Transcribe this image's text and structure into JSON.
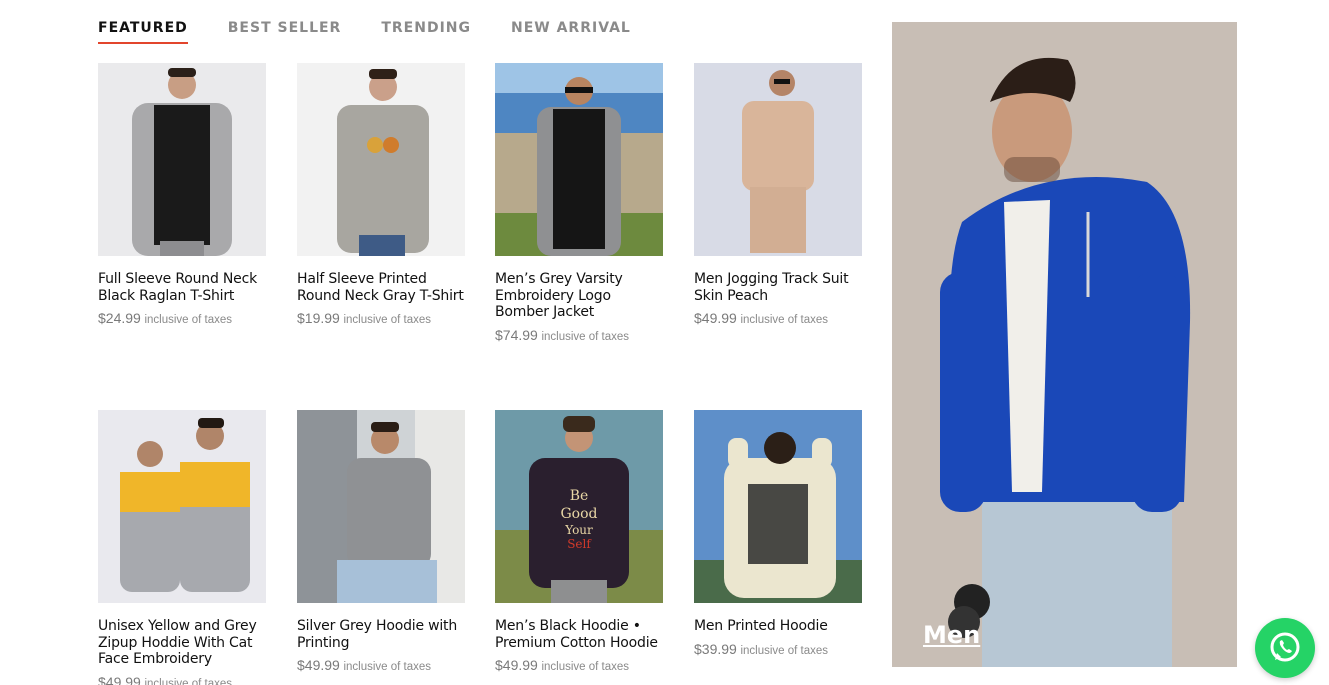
{
  "tabs": [
    {
      "label": "FEATURED",
      "active": true
    },
    {
      "label": "BEST SELLER",
      "active": false
    },
    {
      "label": "TRENDING",
      "active": false
    },
    {
      "label": "NEW ARRIVAL",
      "active": false
    }
  ],
  "tax_note": "inclusive of taxes",
  "products": [
    {
      "title": "Full Sleeve Round Neck Black Raglan T-Shirt",
      "price": "$24.99"
    },
    {
      "title": "Half Sleeve Printed Round Neck Gray T-Shirt",
      "price": "$19.99"
    },
    {
      "title": "Men’s Grey Varsity Embroidery Logo Bomber Jacket",
      "price": "$74.99"
    },
    {
      "title": "Men Jogging Track Suit Skin Peach",
      "price": "$49.99"
    },
    {
      "title": "Unisex Yellow and Grey Zipup Hoddie With Cat Face Embroidery",
      "price": "$49.99"
    },
    {
      "title": "Silver Grey Hoodie with Printing",
      "price": "$49.99"
    },
    {
      "title": "Men’s Black Hoodie • Premium Cotton Hoodie",
      "price": "$49.99"
    },
    {
      "title": "Men Printed Hoodie",
      "price": "$39.99"
    }
  ],
  "banner": {
    "label": "Men"
  },
  "colors": {
    "accent": "#e2452c",
    "whatsapp": "#25d366"
  }
}
